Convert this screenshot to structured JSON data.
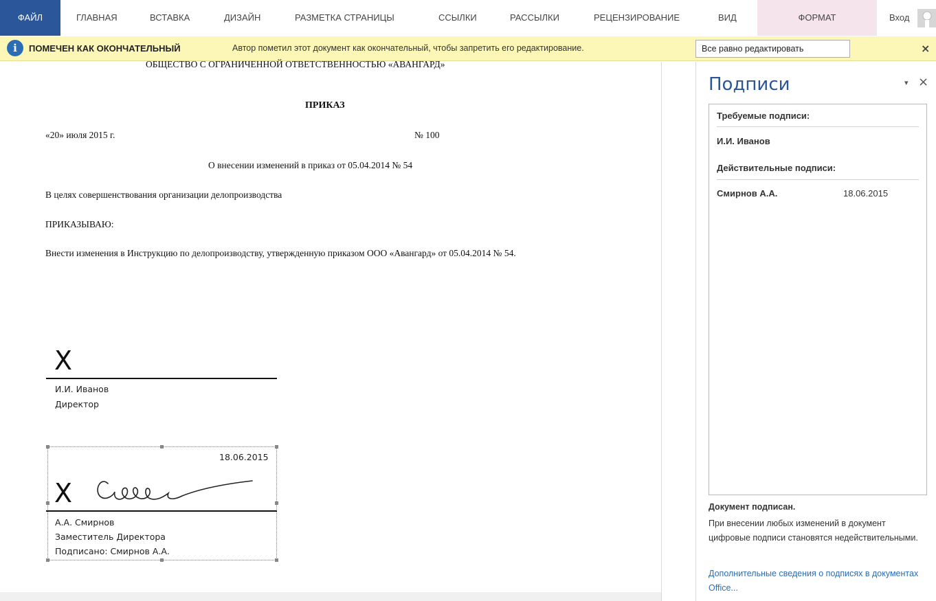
{
  "ribbon": {
    "tabs": [
      {
        "label": "ФАЙЛ"
      },
      {
        "label": "ГЛАВНАЯ"
      },
      {
        "label": "ВСТАВКА"
      },
      {
        "label": "ДИЗАЙН"
      },
      {
        "label": "РАЗМЕТКА СТРАНИЦЫ"
      },
      {
        "label": "ССЫЛКИ"
      },
      {
        "label": "РАССЫЛКИ"
      },
      {
        "label": "РЕЦЕНЗИРОВАНИЕ"
      },
      {
        "label": "ВИД"
      },
      {
        "label": "ФОРМАТ"
      }
    ],
    "signin": "Вход",
    "file_color": "#2b579a",
    "format_color": "#f6e4ec"
  },
  "message_bar": {
    "icon": "info-icon",
    "title": "ПОМЕЧЕН КАК ОКОНЧАТЕЛЬНЫЙ",
    "text": "Автор пометил этот документ как окончательный, чтобы запретить его редактирование.",
    "button": "Все равно редактировать",
    "close": "×",
    "bg_color": "#fcf7b6"
  },
  "document": {
    "org": "ОБЩЕСТВО С ОГРАНИЧЕННОЙ ОТВЕТСТВЕННОСТЬЮ «АВАНГАРД»",
    "title": "ПРИКАЗ",
    "date": "«20» июля 2015 г.",
    "number": "№ 100",
    "subject": "О внесении изменений в приказ от 05.04.2014 № 54",
    "para1": "В целях совершенствования организации делопроизводства",
    "para2": "ПРИКАЗЫВАЮ:",
    "para3": "Внести изменения в Инструкцию по делопроизводству, утвержденную приказом ООО «Авангард» от 05.04.2014 № 54.",
    "signature1": {
      "x": "X",
      "name": "И.И. Иванов",
      "position": "Директор"
    },
    "signature2": {
      "date": "18.06.2015",
      "x": "X",
      "name": "А.А. Смирнов",
      "position": "Заместитель Директора",
      "signed_by": "Подписано: Смирнов А.А."
    }
  },
  "pane": {
    "title": "Подписи",
    "menu_icon": "▾",
    "close": "×",
    "required_header": "Требуемые подписи:",
    "required": [
      {
        "name": "И.И. Иванов"
      }
    ],
    "valid_header": "Действительные подписи:",
    "valid": [
      {
        "name": "Смирнов А.А.",
        "date": "18.06.2015"
      }
    ],
    "status_title": "Документ подписан.",
    "status_text": "При внесении любых изменений в документ цифровые подписи становятся недействительными.",
    "link": "Дополнительные сведения о подписях в документах Office..."
  }
}
